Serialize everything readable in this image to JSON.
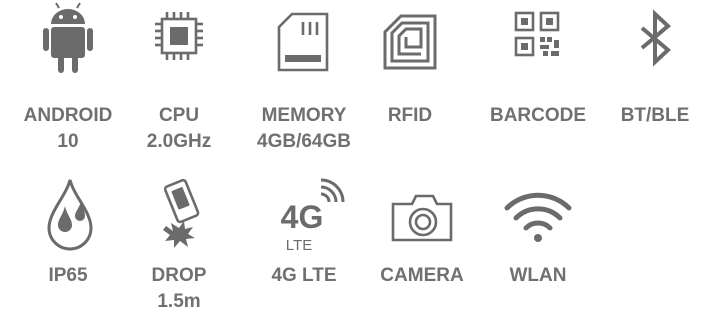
{
  "colors": {
    "icon": "#6b6b6b",
    "text": "#707070",
    "background": "#ffffff"
  },
  "features": [
    {
      "name": "android",
      "icon": "android-icon",
      "line1": "ANDROID",
      "line2": "10"
    },
    {
      "name": "cpu",
      "icon": "cpu-chip-icon",
      "line1": "CPU",
      "line2": "2.0GHz"
    },
    {
      "name": "memory",
      "icon": "memory-card-icon",
      "line1": "MEMORY",
      "line2": "4GB/64GB"
    },
    {
      "name": "rfid",
      "icon": "rfid-icon",
      "line1": "RFID",
      "line2": ""
    },
    {
      "name": "barcode",
      "icon": "qr-code-icon",
      "line1": "BARCODE",
      "line2": ""
    },
    {
      "name": "bt-ble",
      "icon": "bluetooth-icon",
      "line1": "BT/BLE",
      "line2": ""
    },
    {
      "name": "ip65",
      "icon": "water-drop-icon",
      "line1": "IP65",
      "line2": ""
    },
    {
      "name": "drop",
      "icon": "drop-impact-icon",
      "line1": "DROP",
      "line2": "1.5m"
    },
    {
      "name": "4g-lte",
      "icon": "4g-lte-icon",
      "line1": "4G LTE",
      "line2": "",
      "icon_text_main": "4G",
      "icon_text_sub": "LTE"
    },
    {
      "name": "camera",
      "icon": "camera-icon",
      "line1": "CAMERA",
      "line2": ""
    },
    {
      "name": "wlan",
      "icon": "wifi-icon",
      "line1": "WLAN",
      "line2": ""
    }
  ]
}
